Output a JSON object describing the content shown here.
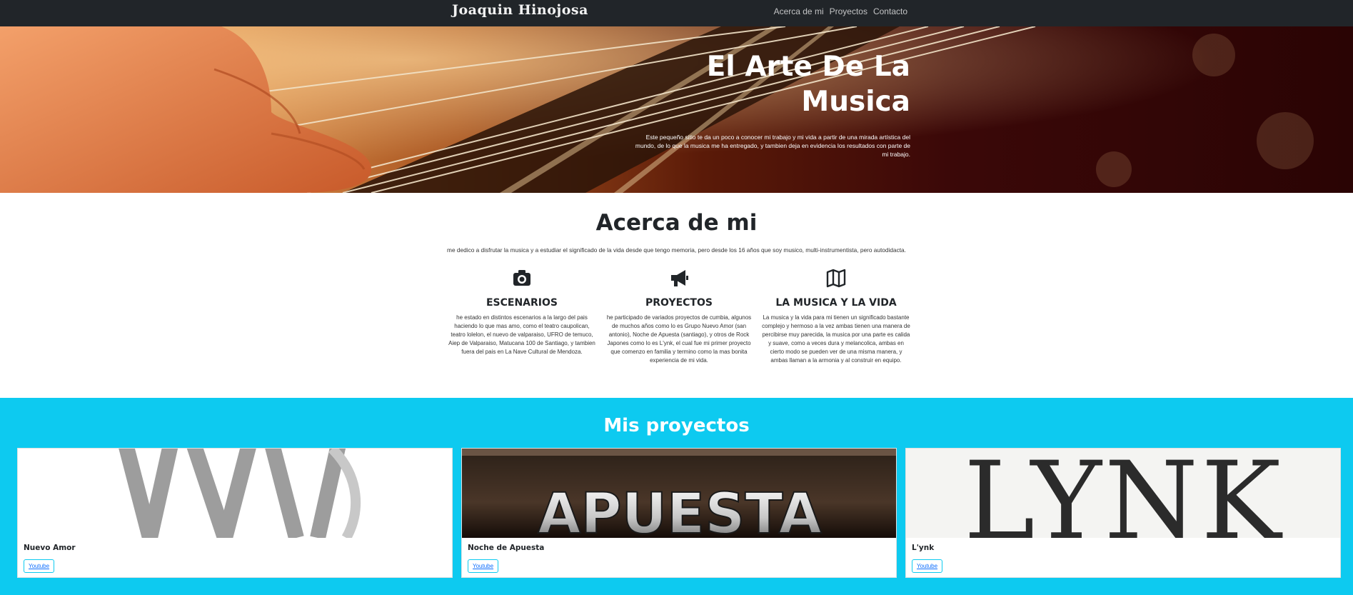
{
  "navbar": {
    "brand": "Joaquin Hinojosa",
    "links": [
      "Acerca de mi",
      "Proyectos",
      "Contacto"
    ]
  },
  "hero": {
    "title": "El Arte De La Musica",
    "text": "Este pequeño sitio te da un poco a conocer mi trabajo y mi vida a partir de una mirada artística del mundo, de lo que la musica me ha entregado, y tambien deja en evidencia los resultados con parte de mi trabajo."
  },
  "about": {
    "title": "Acerca de mi",
    "intro": "me dedico a disfrutar la musica y a estudiar el significado de la vida desde que tengo memoria, pero desde los 16 años que soy musico, multi-instrumentista, pero autodidacta.",
    "features": [
      {
        "icon": "camera-icon",
        "title": "ESCENARIOS",
        "text": "he estado en distintos escenarios a la largo del pais haciendo lo que mas amo, como el teatro caupolican, teatro lolelon, el nuevo de valparaiso, UFRO de temuco, Aiep de Valparaiso, Matucana 100 de Santiago, y tambien fuera del pais en La Nave Cultural de Mendoza."
      },
      {
        "icon": "megaphone-icon",
        "title": "PROYECTOS",
        "text": "he participado de variados proyectos de cumbia, algunos de muchos años como lo es Grupo Nuevo Amor (san antonio), Noche de Apuesta (santiago), y otros de Rock Japones como lo es L'ynk, el cual fue mi primer proyecto que comenzo en familia y termino como la mas bonita experiencia de mi vida."
      },
      {
        "icon": "map-icon",
        "title": "LA MUSICA Y LA VIDA",
        "text": "La musica y la vida para mi tienen un significado bastante complejo y hermoso a la vez ambas tienen una manera de percibirse muy parecida, la musica por una parte es calida y suave, como a veces dura y melancolica, ambas en cierto modo se pueden ver de una misma manera, y ambas llaman a la armonia y al construir en equipo."
      }
    ]
  },
  "projects": {
    "title": "Mis proyectos",
    "cards": [
      {
        "title": "Nuevo Amor",
        "button": "Youtube",
        "image_text": ""
      },
      {
        "title": "Noche de Apuesta",
        "button": "Youtube",
        "image_text": "APUESTA"
      },
      {
        "title": "L'ynk",
        "button": "Youtube",
        "image_text": "LYNK"
      }
    ]
  },
  "colors": {
    "navbar": "#212529",
    "projects_bg": "#0dcaf0",
    "button_border": "#0dcaf0",
    "link": "#0d6efd"
  }
}
